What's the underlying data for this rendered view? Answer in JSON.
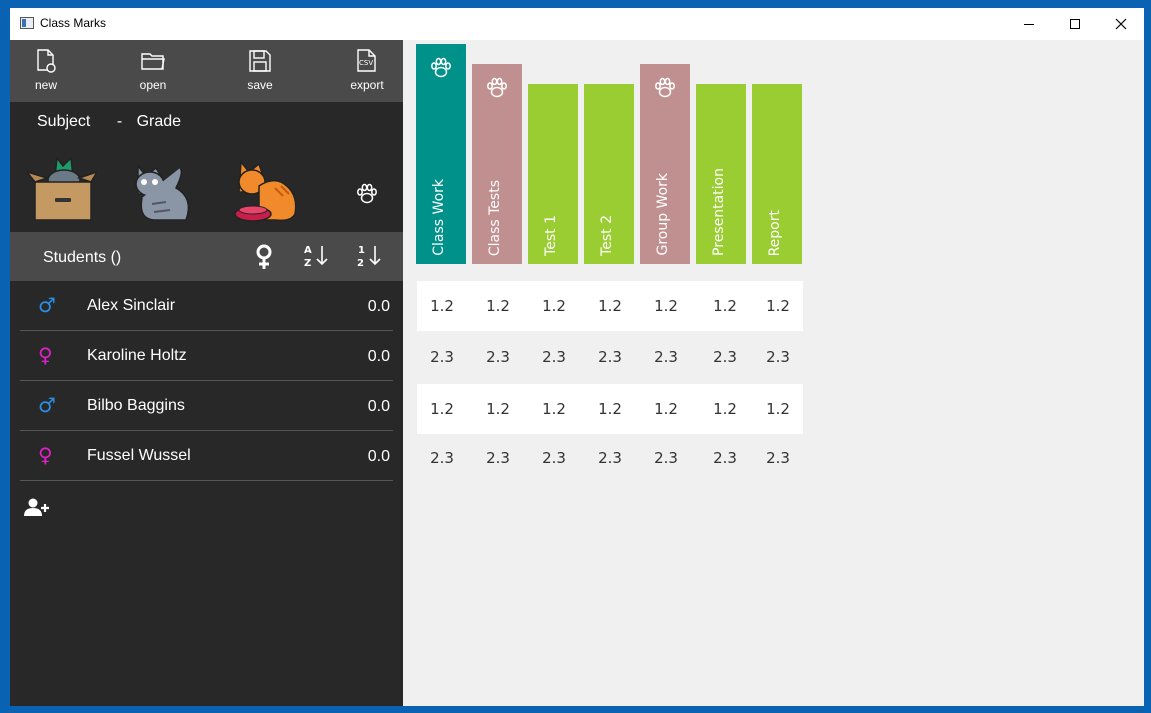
{
  "window": {
    "title": "Class Marks"
  },
  "toolbar": {
    "new_label": "new",
    "open_label": "open",
    "save_label": "save",
    "export_label": "export",
    "export_icon_text": "CSV"
  },
  "subject": {
    "subject_label": "Subject",
    "separator": "-",
    "grade_label": "Grade"
  },
  "students_header": {
    "title": "Students ()",
    "sort_alpha_top": "A",
    "sort_alpha_bottom": "Z",
    "sort_num_top": "1",
    "sort_num_bottom": "2"
  },
  "students": [
    {
      "gender": "male",
      "symbol": "♂",
      "name": "Alex Sinclair",
      "average": "0.0"
    },
    {
      "gender": "female",
      "symbol": "♀",
      "name": "Karoline Holtz",
      "average": "0.0"
    },
    {
      "gender": "male",
      "symbol": "♂",
      "name": "Bilbo Baggins",
      "average": "0.0"
    },
    {
      "gender": "female",
      "symbol": "♀",
      "name": "Fussel Wussel",
      "average": "0.0"
    }
  ],
  "categories": [
    {
      "label": "Class Work",
      "color": "#00928a",
      "paw": true
    },
    {
      "label": "Class Tests",
      "color": "#c09090",
      "paw": true
    },
    {
      "label": "Test 1",
      "color": "#9acd32",
      "paw": false
    },
    {
      "label": "Test 2",
      "color": "#9acd32",
      "paw": false
    },
    {
      "label": "Group Work",
      "color": "#c09090",
      "paw": true
    },
    {
      "label": "Presentation",
      "color": "#9acd32",
      "paw": false
    },
    {
      "label": "Report",
      "color": "#9acd32",
      "paw": false
    }
  ],
  "marks": [
    [
      "1.2",
      "1.2",
      "1.2",
      "1.2",
      "1.2",
      "1.2",
      "1.2"
    ],
    [
      "2.3",
      "2.3",
      "2.3",
      "2.3",
      "2.3",
      "2.3",
      "2.3"
    ],
    [
      "1.2",
      "1.2",
      "1.2",
      "1.2",
      "1.2",
      "1.2",
      "1.2"
    ],
    [
      "2.3",
      "2.3",
      "2.3",
      "2.3",
      "2.3",
      "2.3",
      "2.3"
    ]
  ],
  "colors": {
    "male": "#2a8fe4",
    "female": "#e020c8",
    "teal": "#00928a",
    "rose": "#c09090",
    "green": "#9acd32"
  }
}
